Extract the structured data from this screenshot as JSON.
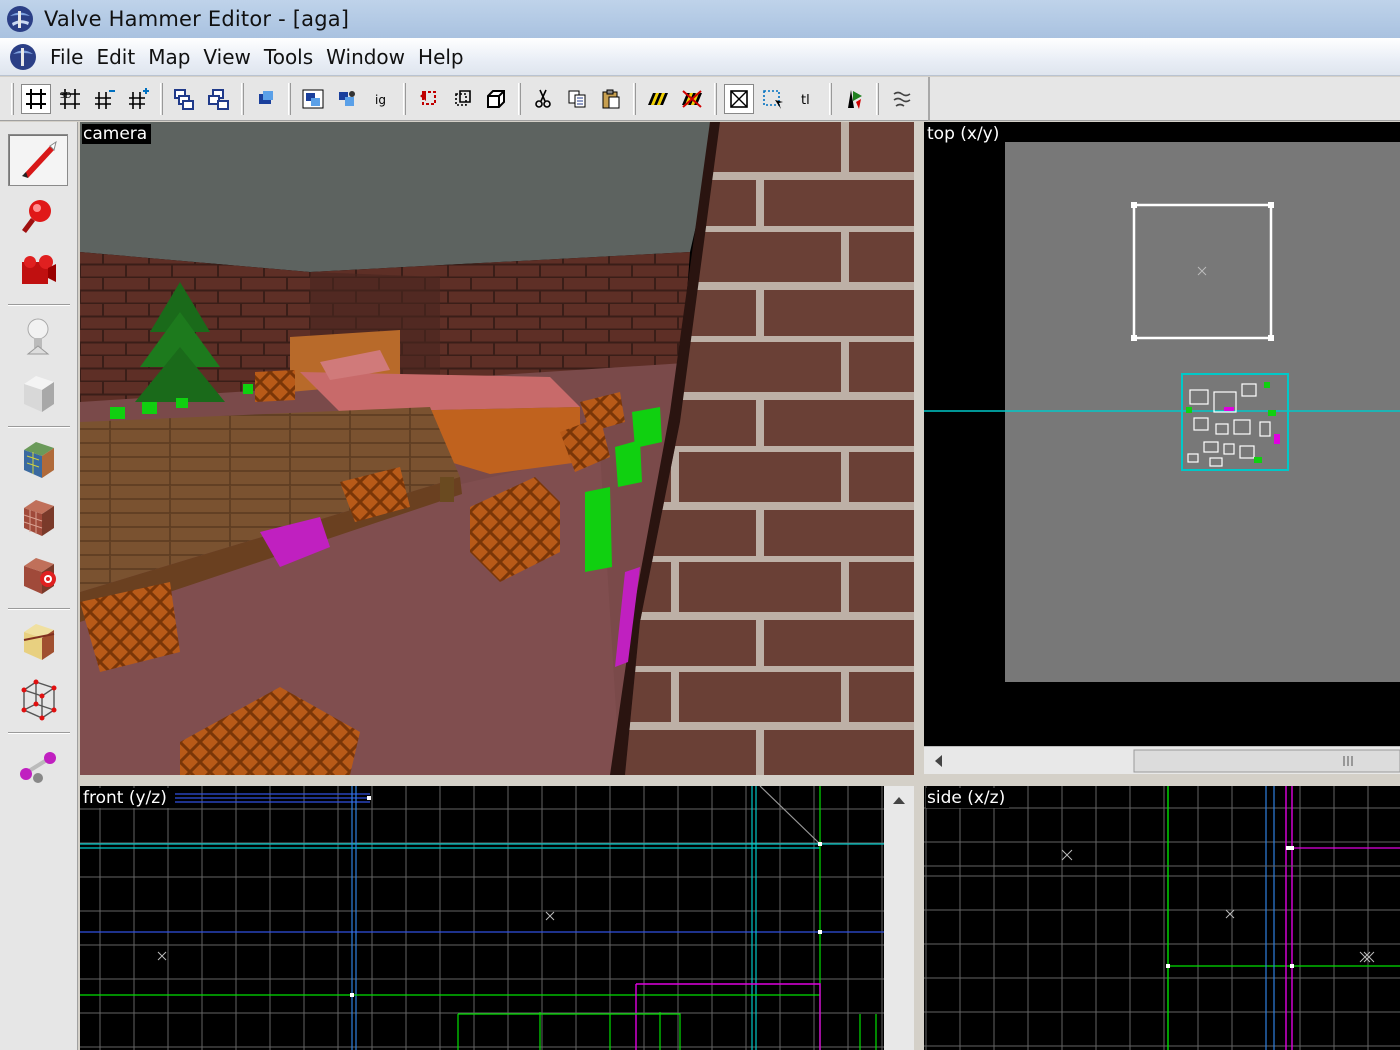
{
  "window": {
    "title": "Valve Hammer Editor - [aga]"
  },
  "menu": {
    "items": [
      "File",
      "Edit",
      "Map",
      "View",
      "Tools",
      "Window",
      "Help"
    ]
  },
  "toolbar": {
    "buttons": [
      {
        "name": "grid-toggle-icon"
      },
      {
        "name": "grid-3d-icon"
      },
      {
        "name": "grid-smaller-icon"
      },
      {
        "name": "grid-larger-icon"
      },
      {
        "name": "group-icon"
      },
      {
        "name": "ungroup-icon"
      },
      {
        "name": "carve-icon"
      },
      {
        "name": "hide-selected-icon"
      },
      {
        "name": "hide-unselected-icon"
      },
      {
        "name": "texture-lock-icon"
      },
      {
        "name": "rotate-icon"
      },
      {
        "name": "flip-icon"
      },
      {
        "name": "clone-icon"
      },
      {
        "name": "cut-icon"
      },
      {
        "name": "copy-icon"
      },
      {
        "name": "paste-icon"
      },
      {
        "name": "texture-lock-toggle-icon"
      },
      {
        "name": "texture-scale-icon"
      },
      {
        "name": "select-by-handles-icon"
      },
      {
        "name": "select-by-edges-icon"
      },
      {
        "name": "select-tl-icon"
      },
      {
        "name": "run-map-icon"
      },
      {
        "name": "entity-report-icon"
      }
    ],
    "tl_label": "tl"
  },
  "toolbox": {
    "tools": [
      {
        "name": "selection-tool-icon"
      },
      {
        "name": "magnify-tool-icon"
      },
      {
        "name": "camera-tool-icon"
      },
      {
        "name": "entity-tool-icon"
      },
      {
        "name": "block-tool-icon"
      },
      {
        "name": "texture-application-icon"
      },
      {
        "name": "apply-texture-icon"
      },
      {
        "name": "decal-tool-icon"
      },
      {
        "name": "clipping-tool-icon"
      },
      {
        "name": "vertex-tool-icon"
      },
      {
        "name": "path-tool-icon"
      }
    ]
  },
  "viewports": {
    "camera": {
      "label": "camera"
    },
    "top": {
      "label": "top (x/y)"
    },
    "front": {
      "label": "front (y/z)"
    },
    "side": {
      "label": "side (x/z)"
    }
  },
  "colors": {
    "grid_bg": "#000000",
    "grid_line": "#646464",
    "top_bg": "#787878",
    "selection_teal": "#00c8c8",
    "brush_green": "#00e000",
    "entity_magenta": "#e000e0",
    "brick": "#5a2c23",
    "carpet": "#7a4a4a"
  }
}
